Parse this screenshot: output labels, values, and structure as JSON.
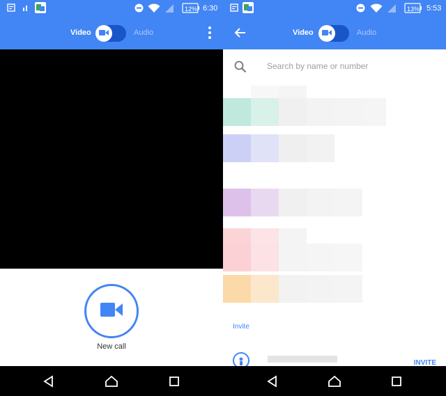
{
  "left": {
    "status": {
      "battery": "12%",
      "time": "6:30"
    },
    "toggle": {
      "video_label": "Video",
      "audio_label": "Audio",
      "selected": "Video"
    },
    "call": {
      "label": "New call"
    }
  },
  "right": {
    "status": {
      "battery": "13%",
      "time": "5:53"
    },
    "toggle": {
      "video_label": "Video",
      "audio_label": "Audio",
      "selected": "Video"
    },
    "search": {
      "placeholder": "Search by name or number",
      "value": ""
    },
    "invite_label": "Invite",
    "invite_button": "INVITE"
  },
  "colors": {
    "accent": "#4285f4",
    "toggle_track": "#1a55c8",
    "nav_bar": "#000000"
  },
  "icons": [
    "calendar-icon",
    "signal-icon",
    "notification-app-icon",
    "do-not-disturb-icon",
    "wifi-icon",
    "cell-signal-icon",
    "battery-icon",
    "video-camera-icon",
    "overflow-menu-icon",
    "back-arrow-icon",
    "search-icon",
    "person-icon",
    "nav-back-icon",
    "nav-home-icon",
    "nav-recents-icon"
  ]
}
